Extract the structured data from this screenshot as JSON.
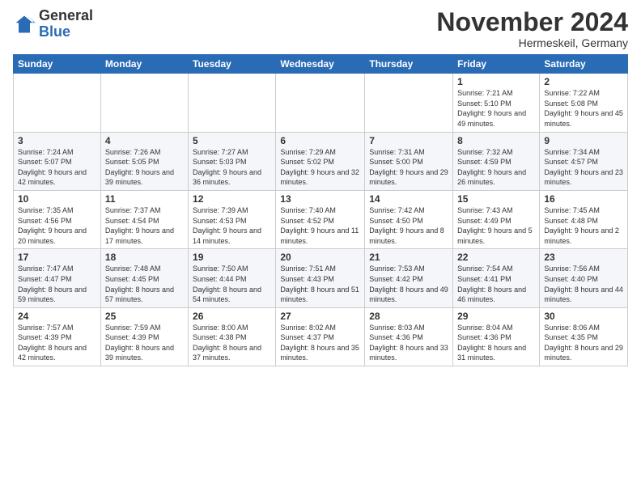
{
  "logo": {
    "general": "General",
    "blue": "Blue"
  },
  "title": "November 2024",
  "location": "Hermeskeil, Germany",
  "days_header": [
    "Sunday",
    "Monday",
    "Tuesday",
    "Wednesday",
    "Thursday",
    "Friday",
    "Saturday"
  ],
  "weeks": [
    {
      "days": [
        {
          "num": "",
          "info": ""
        },
        {
          "num": "",
          "info": ""
        },
        {
          "num": "",
          "info": ""
        },
        {
          "num": "",
          "info": ""
        },
        {
          "num": "",
          "info": ""
        },
        {
          "num": "1",
          "info": "Sunrise: 7:21 AM\nSunset: 5:10 PM\nDaylight: 9 hours and 49 minutes."
        },
        {
          "num": "2",
          "info": "Sunrise: 7:22 AM\nSunset: 5:08 PM\nDaylight: 9 hours and 45 minutes."
        }
      ]
    },
    {
      "days": [
        {
          "num": "3",
          "info": "Sunrise: 7:24 AM\nSunset: 5:07 PM\nDaylight: 9 hours and 42 minutes."
        },
        {
          "num": "4",
          "info": "Sunrise: 7:26 AM\nSunset: 5:05 PM\nDaylight: 9 hours and 39 minutes."
        },
        {
          "num": "5",
          "info": "Sunrise: 7:27 AM\nSunset: 5:03 PM\nDaylight: 9 hours and 36 minutes."
        },
        {
          "num": "6",
          "info": "Sunrise: 7:29 AM\nSunset: 5:02 PM\nDaylight: 9 hours and 32 minutes."
        },
        {
          "num": "7",
          "info": "Sunrise: 7:31 AM\nSunset: 5:00 PM\nDaylight: 9 hours and 29 minutes."
        },
        {
          "num": "8",
          "info": "Sunrise: 7:32 AM\nSunset: 4:59 PM\nDaylight: 9 hours and 26 minutes."
        },
        {
          "num": "9",
          "info": "Sunrise: 7:34 AM\nSunset: 4:57 PM\nDaylight: 9 hours and 23 minutes."
        }
      ]
    },
    {
      "days": [
        {
          "num": "10",
          "info": "Sunrise: 7:35 AM\nSunset: 4:56 PM\nDaylight: 9 hours and 20 minutes."
        },
        {
          "num": "11",
          "info": "Sunrise: 7:37 AM\nSunset: 4:54 PM\nDaylight: 9 hours and 17 minutes."
        },
        {
          "num": "12",
          "info": "Sunrise: 7:39 AM\nSunset: 4:53 PM\nDaylight: 9 hours and 14 minutes."
        },
        {
          "num": "13",
          "info": "Sunrise: 7:40 AM\nSunset: 4:52 PM\nDaylight: 9 hours and 11 minutes."
        },
        {
          "num": "14",
          "info": "Sunrise: 7:42 AM\nSunset: 4:50 PM\nDaylight: 9 hours and 8 minutes."
        },
        {
          "num": "15",
          "info": "Sunrise: 7:43 AM\nSunset: 4:49 PM\nDaylight: 9 hours and 5 minutes."
        },
        {
          "num": "16",
          "info": "Sunrise: 7:45 AM\nSunset: 4:48 PM\nDaylight: 9 hours and 2 minutes."
        }
      ]
    },
    {
      "days": [
        {
          "num": "17",
          "info": "Sunrise: 7:47 AM\nSunset: 4:47 PM\nDaylight: 8 hours and 59 minutes."
        },
        {
          "num": "18",
          "info": "Sunrise: 7:48 AM\nSunset: 4:45 PM\nDaylight: 8 hours and 57 minutes."
        },
        {
          "num": "19",
          "info": "Sunrise: 7:50 AM\nSunset: 4:44 PM\nDaylight: 8 hours and 54 minutes."
        },
        {
          "num": "20",
          "info": "Sunrise: 7:51 AM\nSunset: 4:43 PM\nDaylight: 8 hours and 51 minutes."
        },
        {
          "num": "21",
          "info": "Sunrise: 7:53 AM\nSunset: 4:42 PM\nDaylight: 8 hours and 49 minutes."
        },
        {
          "num": "22",
          "info": "Sunrise: 7:54 AM\nSunset: 4:41 PM\nDaylight: 8 hours and 46 minutes."
        },
        {
          "num": "23",
          "info": "Sunrise: 7:56 AM\nSunset: 4:40 PM\nDaylight: 8 hours and 44 minutes."
        }
      ]
    },
    {
      "days": [
        {
          "num": "24",
          "info": "Sunrise: 7:57 AM\nSunset: 4:39 PM\nDaylight: 8 hours and 42 minutes."
        },
        {
          "num": "25",
          "info": "Sunrise: 7:59 AM\nSunset: 4:39 PM\nDaylight: 8 hours and 39 minutes."
        },
        {
          "num": "26",
          "info": "Sunrise: 8:00 AM\nSunset: 4:38 PM\nDaylight: 8 hours and 37 minutes."
        },
        {
          "num": "27",
          "info": "Sunrise: 8:02 AM\nSunset: 4:37 PM\nDaylight: 8 hours and 35 minutes."
        },
        {
          "num": "28",
          "info": "Sunrise: 8:03 AM\nSunset: 4:36 PM\nDaylight: 8 hours and 33 minutes."
        },
        {
          "num": "29",
          "info": "Sunrise: 8:04 AM\nSunset: 4:36 PM\nDaylight: 8 hours and 31 minutes."
        },
        {
          "num": "30",
          "info": "Sunrise: 8:06 AM\nSunset: 4:35 PM\nDaylight: 8 hours and 29 minutes."
        }
      ]
    }
  ]
}
